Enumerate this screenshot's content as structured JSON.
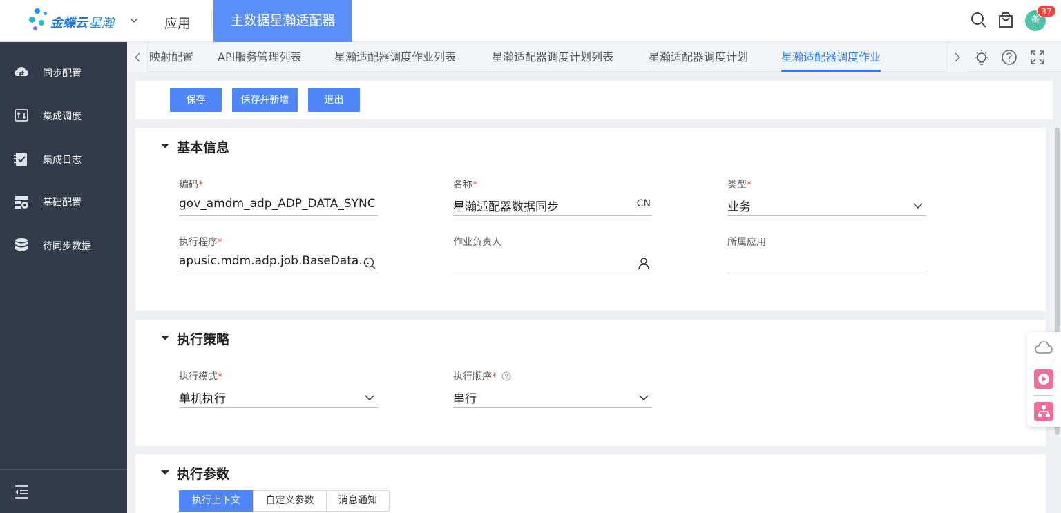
{
  "header": {
    "brand_name": "金蝶云",
    "brand_sub": "星瀚",
    "nav_app": "应用",
    "nav_active": "主数据星瀚适配器",
    "notification_count": "37",
    "avatar_text": "备"
  },
  "sidebar": {
    "items": [
      {
        "label": "同步配置",
        "icon": "cloud-sync-icon"
      },
      {
        "label": "集成调度",
        "icon": "schedule-icon"
      },
      {
        "label": "集成日志",
        "icon": "log-check-icon"
      },
      {
        "label": "基础配置",
        "icon": "config-icon"
      },
      {
        "label": "待同步数据",
        "icon": "database-icon"
      }
    ]
  },
  "tabs": {
    "items": [
      "映射配置",
      "API服务管理列表",
      "星瀚适配器调度作业列表",
      "星瀚适配器调度计划列表",
      "星瀚适配器调度计划",
      "星瀚适配器调度作业"
    ],
    "active_index": 5
  },
  "toolbar": {
    "save_label": "保存",
    "save_new_label": "保存并新增",
    "exit_label": "退出"
  },
  "basic_info": {
    "title": "基本信息",
    "code": {
      "label": "编码",
      "required": "*",
      "value": "gov_amdm_adp_ADP_DATA_SYNC"
    },
    "name": {
      "label": "名称",
      "required": "*",
      "value": "星瀚适配器数据同步",
      "suffix": "CN"
    },
    "type": {
      "label": "类型",
      "required": "*",
      "value": "业务"
    },
    "program": {
      "label": "执行程序",
      "required": "*",
      "value": "apusic.mdm.adp.job.BaseData..."
    },
    "owner": {
      "label": "作业负责人",
      "value": ""
    },
    "app": {
      "label": "所属应用",
      "value": ""
    }
  },
  "exec_strategy": {
    "title": "执行策略",
    "mode": {
      "label": "执行模式",
      "required": "*",
      "value": "单机执行"
    },
    "order": {
      "label": "执行顺序",
      "required": "*",
      "value": "串行"
    }
  },
  "exec_params": {
    "title": "执行参数",
    "tabs": [
      "执行上下文",
      "自定义参数",
      "消息通知"
    ],
    "active_index": 0
  },
  "colors": {
    "primary": "#4d86f7",
    "sidebar": "#333a49",
    "nav_active": "#5b8ff9",
    "required": "#f04134",
    "badge": "#f0433e"
  }
}
